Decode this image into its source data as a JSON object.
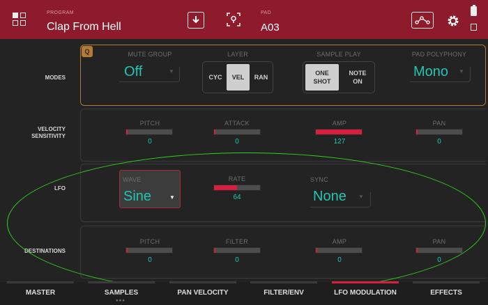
{
  "header": {
    "program_label": "PROGRAM",
    "program_name": "Clap From Hell",
    "pad_label": "PAD",
    "pad_value": "A03",
    "icons": [
      "grid-icon",
      "download-icon",
      "locate-pad-icon",
      "routing-icon",
      "gear-icon",
      "battery-icon",
      "chip-icon"
    ],
    "accent_color": "#8e1b2c"
  },
  "modes": {
    "row_label": "MODES",
    "q_badge": "Q",
    "mute_group": {
      "label": "MUTE GROUP",
      "value": "Off"
    },
    "layer": {
      "label": "LAYER",
      "options": [
        "CYC",
        "VEL",
        "RAN"
      ],
      "selected": "VEL"
    },
    "sample_play": {
      "label": "SAMPLE PLAY",
      "options": [
        "ONE SHOT",
        "NOTE ON"
      ],
      "selected": "ONE SHOT"
    },
    "pad_polyphony": {
      "label": "PAD POLYPHONY",
      "value": "Mono"
    }
  },
  "velocity": {
    "row_label_line1": "VELOCITY",
    "row_label_line2": "SENSITIVITY",
    "pitch": {
      "label": "PITCH",
      "value": "0",
      "level": 0
    },
    "attack": {
      "label": "ATTACK",
      "value": "0",
      "level": 0
    },
    "amp": {
      "label": "AMP",
      "value": "127",
      "level": 1.0
    },
    "pan": {
      "label": "PAN",
      "value": "0",
      "level": 0
    }
  },
  "lfo": {
    "row_label": "LFO",
    "wave": {
      "label": "WAVE",
      "value": "Sine"
    },
    "rate": {
      "label": "RATE",
      "value": "64",
      "level": 0.5
    },
    "sync": {
      "label": "SYNC",
      "value": "None"
    }
  },
  "destinations": {
    "row_label": "DESTINATIONS",
    "pitch": {
      "label": "PITCH",
      "value": "0",
      "level": 0
    },
    "filter": {
      "label": "FILTER",
      "value": "0",
      "level": 0
    },
    "amp": {
      "label": "AMP",
      "value": "0",
      "level": 0
    },
    "pan": {
      "label": "PAN",
      "value": "0",
      "level": 0
    }
  },
  "tabs": {
    "items": [
      "MASTER",
      "SAMPLES",
      "PAN VELOCITY",
      "FILTER/ENV",
      "LFO MODULATION",
      "EFFECTS"
    ],
    "active": "LFO MODULATION"
  },
  "colors": {
    "value_teal": "#20c6b1",
    "slider_red": "#d71f40",
    "highlight_green": "#33d11f",
    "panel_orange": "#b27a35"
  }
}
